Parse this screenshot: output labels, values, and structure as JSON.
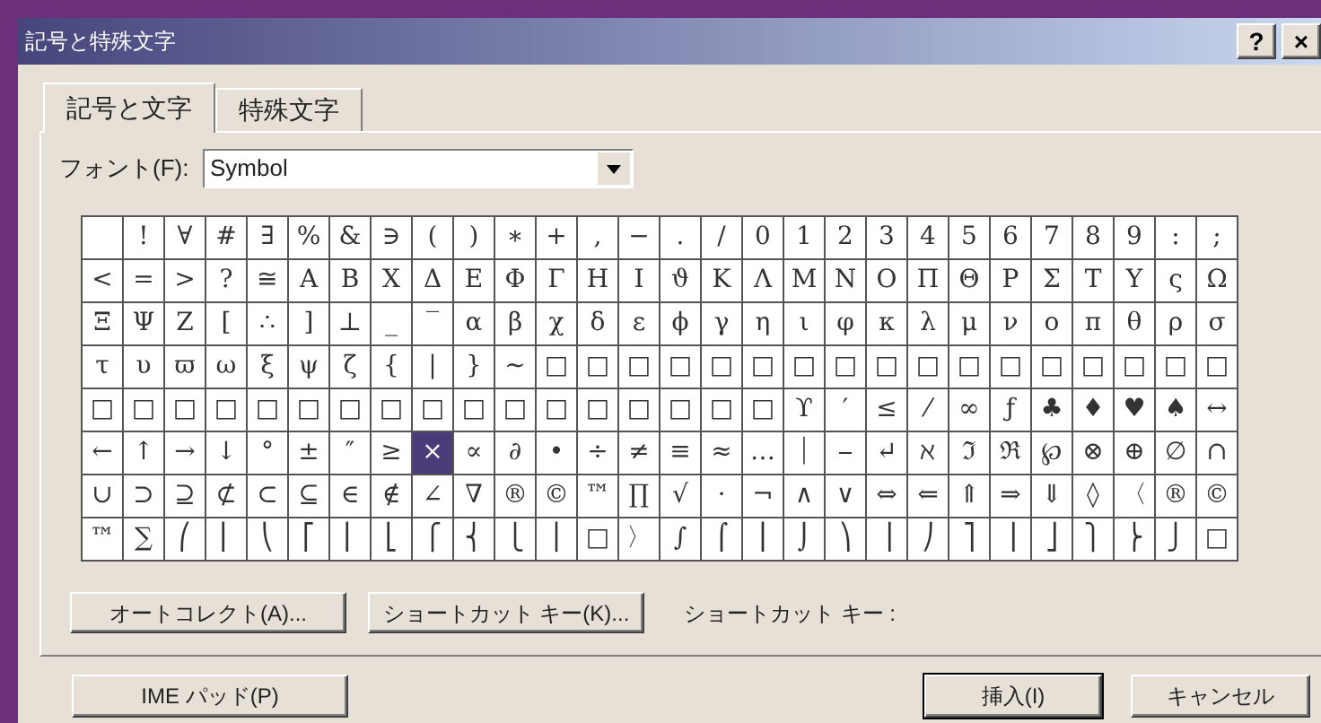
{
  "window": {
    "title": "記号と特殊文字",
    "buttons": [
      "?",
      "×"
    ]
  },
  "tabs": [
    {
      "label": "記号と文字",
      "selected": true
    },
    {
      "label": "特殊文字",
      "selected": false
    }
  ],
  "font": {
    "label": "フォント(F):",
    "value": "Symbol"
  },
  "grid": {
    "rows": [
      {
        "cells": [
          {
            "selected": false
          },
          {
            "char": "!",
            "selected": false
          },
          {
            "char": "∀",
            "selected": false
          },
          {
            "char": "#",
            "selected": false
          },
          {
            "char": "∃",
            "selected": false
          },
          {
            "char": "%",
            "selected": false
          },
          {
            "char": "&",
            "selected": false
          },
          {
            "char": "∋",
            "selected": false
          },
          {
            "char": "(",
            "selected": false
          },
          {
            "char": ")",
            "selected": false
          },
          {
            "char": "∗",
            "selected": false
          },
          {
            "char": "+",
            "selected": false
          },
          {
            "char": ",",
            "selected": false
          },
          {
            "char": "−",
            "selected": false
          },
          {
            "char": ".",
            "selected": false
          },
          {
            "char": "/",
            "selected": false
          },
          {
            "char": "0",
            "selected": false
          },
          {
            "char": "1",
            "selected": false
          },
          {
            "char": "2",
            "selected": false
          },
          {
            "char": "3",
            "selected": false
          },
          {
            "char": "4",
            "selected": false
          },
          {
            "char": "5",
            "selected": false
          },
          {
            "char": "6",
            "selected": false
          },
          {
            "char": "7",
            "selected": false
          },
          {
            "char": "8",
            "selected": false
          },
          {
            "char": "9",
            "selected": false
          },
          {
            "char": ":",
            "selected": false
          },
          {
            "char": ";",
            "selected": false
          }
        ]
      },
      {
        "cells": [
          {
            "char": "<",
            "selected": false
          },
          {
            "char": "=",
            "selected": false
          },
          {
            "char": ">",
            "selected": false
          },
          {
            "char": "?",
            "selected": false
          },
          {
            "char": "≅",
            "selected": false
          },
          {
            "char": "Α",
            "selected": false
          },
          {
            "char": "Β",
            "selected": false
          },
          {
            "char": "Χ",
            "selected": false
          },
          {
            "char": "Δ",
            "selected": false
          },
          {
            "char": "Ε",
            "selected": false
          },
          {
            "char": "Φ",
            "selected": false
          },
          {
            "char": "Γ",
            "selected": false
          },
          {
            "char": "Η",
            "selected": false
          },
          {
            "char": "Ι",
            "selected": false
          },
          {
            "char": "ϑ",
            "selected": false
          },
          {
            "char": "Κ",
            "selected": false
          },
          {
            "char": "Λ",
            "selected": false
          },
          {
            "char": "Μ",
            "selected": false
          },
          {
            "char": "Ν",
            "selected": false
          },
          {
            "char": "Ο",
            "selected": false
          },
          {
            "char": "Π",
            "selected": false
          },
          {
            "char": "Θ",
            "selected": false
          },
          {
            "char": "Ρ",
            "selected": false
          },
          {
            "char": "Σ",
            "selected": false
          },
          {
            "char": "Τ",
            "selected": false
          },
          {
            "char": "Υ",
            "selected": false
          },
          {
            "char": "ς",
            "selected": false
          },
          {
            "char": "Ω",
            "selected": false
          }
        ]
      },
      {
        "cells": [
          {
            "char": "Ξ",
            "selected": false
          },
          {
            "char": "Ψ",
            "selected": false
          },
          {
            "char": "Ζ",
            "selected": false
          },
          {
            "char": "[",
            "selected": false
          },
          {
            "char": "∴",
            "selected": false
          },
          {
            "char": "]",
            "selected": false
          },
          {
            "char": "⊥",
            "selected": false
          },
          {
            "char": "_",
            "selected": false
          },
          {
            "char": "‾",
            "selected": false
          },
          {
            "char": "α",
            "selected": false
          },
          {
            "char": "β",
            "selected": false
          },
          {
            "char": "χ",
            "selected": false
          },
          {
            "char": "δ",
            "selected": false
          },
          {
            "char": "ε",
            "selected": false
          },
          {
            "char": "ϕ",
            "selected": false
          },
          {
            "char": "γ",
            "selected": false
          },
          {
            "char": "η",
            "selected": false
          },
          {
            "char": "ι",
            "selected": false
          },
          {
            "char": "φ",
            "selected": false
          },
          {
            "char": "κ",
            "selected": false
          },
          {
            "char": "λ",
            "selected": false
          },
          {
            "char": "μ",
            "selected": false
          },
          {
            "char": "ν",
            "selected": false
          },
          {
            "char": "ο",
            "selected": false
          },
          {
            "char": "π",
            "selected": false
          },
          {
            "char": "θ",
            "selected": false
          },
          {
            "char": "ρ",
            "selected": false
          },
          {
            "char": "σ",
            "selected": false
          }
        ]
      },
      {
        "cells": [
          {
            "char": "τ",
            "selected": false
          },
          {
            "char": "υ",
            "selected": false
          },
          {
            "char": "ϖ",
            "selected": false
          },
          {
            "char": "ω",
            "selected": false
          },
          {
            "char": "ξ",
            "selected": false
          },
          {
            "char": "ψ",
            "selected": false
          },
          {
            "char": "ζ",
            "selected": false
          },
          {
            "char": "{",
            "selected": false
          },
          {
            "char": "|",
            "selected": false
          },
          {
            "char": "}",
            "selected": false
          },
          {
            "char": "~",
            "selected": false
          },
          {
            "char": "□",
            "selected": false
          },
          {
            "char": "□",
            "selected": false
          },
          {
            "char": "□",
            "selected": false
          },
          {
            "char": "□",
            "selected": false
          },
          {
            "char": "□",
            "selected": false
          },
          {
            "char": "□",
            "selected": false
          },
          {
            "char": "□",
            "selected": false
          },
          {
            "char": "□",
            "selected": false
          },
          {
            "char": "□",
            "selected": false
          },
          {
            "char": "□",
            "selected": false
          },
          {
            "char": "□",
            "selected": false
          },
          {
            "char": "□",
            "selected": false
          },
          {
            "char": "□",
            "selected": false
          },
          {
            "char": "□",
            "selected": false
          },
          {
            "char": "□",
            "selected": false
          },
          {
            "char": "□",
            "selected": false
          },
          {
            "char": "□",
            "selected": false
          }
        ]
      },
      {
        "cells": [
          {
            "char": "□",
            "selected": false
          },
          {
            "char": "□",
            "selected": false
          },
          {
            "char": "□",
            "selected": false
          },
          {
            "char": "□",
            "selected": false
          },
          {
            "char": "□",
            "selected": false
          },
          {
            "char": "□",
            "selected": false
          },
          {
            "char": "□",
            "selected": false
          },
          {
            "char": "□",
            "selected": false
          },
          {
            "char": "□",
            "selected": false
          },
          {
            "char": "□",
            "selected": false
          },
          {
            "char": "□",
            "selected": false
          },
          {
            "char": "□",
            "selected": false
          },
          {
            "char": "□",
            "selected": false
          },
          {
            "char": "□",
            "selected": false
          },
          {
            "char": "□",
            "selected": false
          },
          {
            "char": "□",
            "selected": false
          },
          {
            "char": "□",
            "selected": false
          },
          {
            "char": "ϒ",
            "selected": false
          },
          {
            "char": "′",
            "selected": false
          },
          {
            "char": "≤",
            "selected": false
          },
          {
            "char": "⁄",
            "selected": false
          },
          {
            "char": "∞",
            "selected": false
          },
          {
            "char": "ƒ",
            "selected": false
          },
          {
            "char": "♣",
            "selected": false
          },
          {
            "char": "♦",
            "selected": false
          },
          {
            "char": "♥",
            "selected": false
          },
          {
            "char": "♠",
            "selected": false
          },
          {
            "char": "↔",
            "selected": false
          }
        ]
      },
      {
        "cells": [
          {
            "char": "←",
            "selected": false
          },
          {
            "char": "↑",
            "selected": false
          },
          {
            "char": "→",
            "selected": false
          },
          {
            "char": "↓",
            "selected": false
          },
          {
            "char": "°",
            "selected": false
          },
          {
            "char": "±",
            "selected": false
          },
          {
            "char": "″",
            "selected": false
          },
          {
            "char": "≥",
            "selected": false
          },
          {
            "char": "×",
            "selected": true
          },
          {
            "char": "∝",
            "selected": false
          },
          {
            "char": "∂",
            "selected": false
          },
          {
            "char": "•",
            "selected": false
          },
          {
            "char": "÷",
            "selected": false
          },
          {
            "char": "≠",
            "selected": false
          },
          {
            "char": "≡",
            "selected": false
          },
          {
            "char": "≈",
            "selected": false
          },
          {
            "char": "…",
            "selected": false
          },
          {
            "char": "⏐",
            "selected": false
          },
          {
            "char": "⎯",
            "selected": false
          },
          {
            "char": "↵",
            "selected": false
          },
          {
            "char": "ℵ",
            "selected": false
          },
          {
            "char": "ℑ",
            "selected": false
          },
          {
            "char": "ℜ",
            "selected": false
          },
          {
            "char": "℘",
            "selected": false
          },
          {
            "char": "⊗",
            "selected": false
          },
          {
            "char": "⊕",
            "selected": false
          },
          {
            "char": "∅",
            "selected": false
          },
          {
            "char": "∩",
            "selected": false
          }
        ]
      },
      {
        "cells": [
          {
            "char": "∪",
            "selected": false
          },
          {
            "char": "⊃",
            "selected": false
          },
          {
            "char": "⊇",
            "selected": false
          },
          {
            "char": "⊄",
            "selected": false
          },
          {
            "char": "⊂",
            "selected": false
          },
          {
            "char": "⊆",
            "selected": false
          },
          {
            "char": "∈",
            "selected": false
          },
          {
            "char": "∉",
            "selected": false
          },
          {
            "char": "∠",
            "selected": false
          },
          {
            "char": "∇",
            "selected": false
          },
          {
            "char": "®",
            "selected": false
          },
          {
            "char": "©",
            "selected": false
          },
          {
            "char": "™",
            "selected": false
          },
          {
            "char": "∏",
            "selected": false
          },
          {
            "char": "√",
            "selected": false
          },
          {
            "char": "⋅",
            "selected": false
          },
          {
            "char": "¬",
            "selected": false
          },
          {
            "char": "∧",
            "selected": false
          },
          {
            "char": "∨",
            "selected": false
          },
          {
            "char": "⇔",
            "selected": false
          },
          {
            "char": "⇐",
            "selected": false
          },
          {
            "char": "⇑",
            "selected": false
          },
          {
            "char": "⇒",
            "selected": false
          },
          {
            "char": "⇓",
            "selected": false
          },
          {
            "char": "◊",
            "selected": false
          },
          {
            "char": "〈",
            "selected": false
          },
          {
            "char": "®",
            "selected": false
          },
          {
            "char": "©",
            "selected": false
          }
        ]
      },
      {
        "cells": [
          {
            "char": "™",
            "selected": false
          },
          {
            "char": "∑",
            "selected": false
          },
          {
            "char": "⎛",
            "selected": false
          },
          {
            "char": "⎜",
            "selected": false
          },
          {
            "char": "⎝",
            "selected": false
          },
          {
            "char": "⎡",
            "selected": false
          },
          {
            "char": "⎢",
            "selected": false
          },
          {
            "char": "⎣",
            "selected": false
          },
          {
            "char": "⎧",
            "selected": false
          },
          {
            "char": "⎨",
            "selected": false
          },
          {
            "char": "⎩",
            "selected": false
          },
          {
            "char": "⎪",
            "selected": false
          },
          {
            "char": "□",
            "selected": false
          },
          {
            "char": "〉",
            "selected": false
          },
          {
            "char": "∫",
            "selected": false
          },
          {
            "char": "⌠",
            "selected": false
          },
          {
            "char": "⎮",
            "selected": false
          },
          {
            "char": "⌡",
            "selected": false
          },
          {
            "char": "⎞",
            "selected": false
          },
          {
            "char": "⎟",
            "selected": false
          },
          {
            "char": "⎠",
            "selected": false
          },
          {
            "char": "⎤",
            "selected": false
          },
          {
            "char": "⎥",
            "selected": false
          },
          {
            "char": "⎦",
            "selected": false
          },
          {
            "char": "⎫",
            "selected": false
          },
          {
            "char": "⎬",
            "selected": false
          },
          {
            "char": "⎭",
            "selected": false
          },
          {
            "char": "□",
            "selected": false
          }
        ]
      }
    ]
  },
  "panel_buttons": [
    "オートコレクト(A)...",
    "ショートカット キー(K)..."
  ],
  "shortcut_label": "ショートカット キー :",
  "footer": {
    "ime_button": "IME パッド(P)",
    "buttons": [
      {
        "label": "挿入(I)",
        "default": true
      },
      {
        "label": "キャンセル",
        "default": false
      }
    ]
  }
}
